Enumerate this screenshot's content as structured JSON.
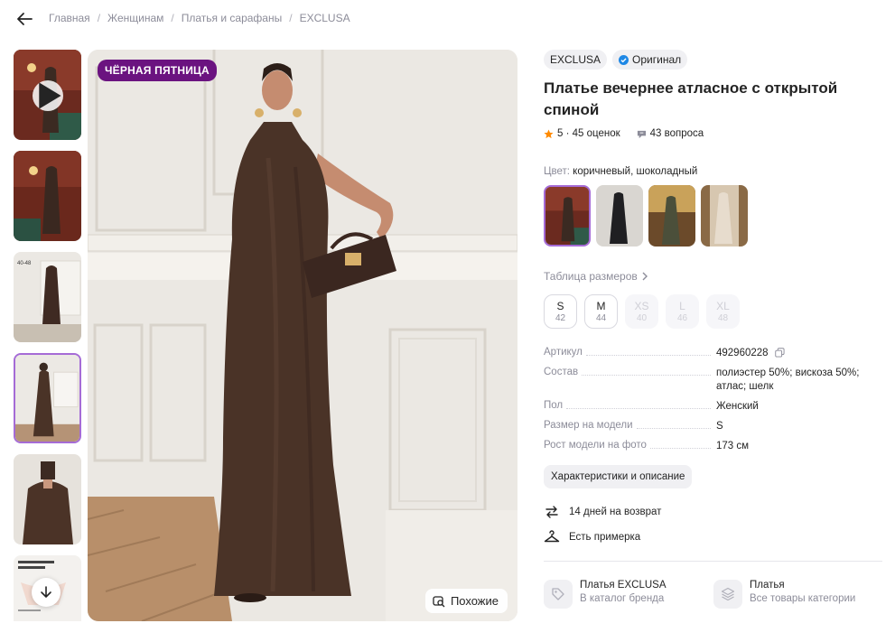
{
  "breadcrumb": [
    "Главная",
    "Женщинам",
    "Платья и сарафаны",
    "EXCLUSA"
  ],
  "gallery": {
    "promo_badge": "ЧЁРНАЯ ПЯТНИЦА",
    "similar_label": "Похожие"
  },
  "product": {
    "brand": "EXCLUSA",
    "original_label": "Оригинал",
    "title": "Платье вечернее атласное с открытой спиной",
    "rating": "5 · 45 оценок",
    "questions": "43 вопроса",
    "color_key": "Цвет:",
    "color_value": "коричневый, шоколадный",
    "size_table_label": "Таблица размеров",
    "sizes": [
      {
        "name": "S",
        "ru": "42",
        "available": true
      },
      {
        "name": "M",
        "ru": "44",
        "available": true
      },
      {
        "name": "XS",
        "ru": "40",
        "available": false
      },
      {
        "name": "L",
        "ru": "46",
        "available": false
      },
      {
        "name": "XL",
        "ru": "48",
        "available": false
      }
    ],
    "specs": [
      {
        "key": "Артикул",
        "value": "492960228"
      },
      {
        "key": "Состав",
        "value": "полиэстер 50%; вискоза 50%; атлас; шелк"
      },
      {
        "key": "Пол",
        "value": "Женский"
      },
      {
        "key": "Размер на модели",
        "value": "S"
      },
      {
        "key": "Рост модели на фото",
        "value": "173 см"
      }
    ],
    "characteristics_button": "Характеристики и описание",
    "perks": [
      "14 дней на возврат",
      "Есть примерка"
    ],
    "links": [
      {
        "title": "Платья EXCLUSA",
        "subtitle": "В каталог бренда"
      },
      {
        "title": "Платья",
        "subtitle": "Все товары категории"
      }
    ]
  },
  "colors": {
    "accent": "#a56bd6",
    "promo": "#6b1380",
    "rating_star": "#ff8a00",
    "verified": "#1e88e5"
  }
}
